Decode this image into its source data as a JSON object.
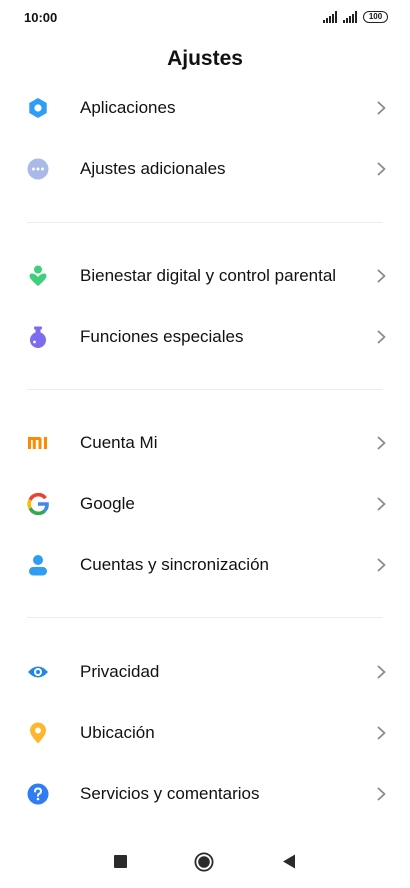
{
  "status": {
    "time": "10:00",
    "battery": "100"
  },
  "header": {
    "title": "Ajustes"
  },
  "items": [
    {
      "label": "Aplicaciones",
      "icon": "gear-icon"
    },
    {
      "label": "Ajustes adicionales",
      "icon": "more-dots-icon"
    },
    {
      "label": "Bienestar digital y control parental",
      "icon": "wellbeing-icon"
    },
    {
      "label": "Funciones especiales",
      "icon": "potion-icon"
    },
    {
      "label": "Cuenta Mi",
      "icon": "mi-logo-icon"
    },
    {
      "label": "Google",
      "icon": "google-icon"
    },
    {
      "label": "Cuentas y sincronización",
      "icon": "person-icon"
    },
    {
      "label": "Privacidad",
      "icon": "eye-icon"
    },
    {
      "label": "Ubicación",
      "icon": "location-pin-icon"
    },
    {
      "label": "Servicios y comentarios",
      "icon": "help-icon"
    }
  ],
  "colors": {
    "gear": "#2f9cf5",
    "dots": "#a9b9e8",
    "wellbeing": "#3ecf7a",
    "potion": "#7b6cf0",
    "mi": "#ff8a00",
    "person": "#2f9cf5",
    "eye": "#1e88e5",
    "pin": "#ffb62e",
    "help": "#2f7cf5"
  }
}
